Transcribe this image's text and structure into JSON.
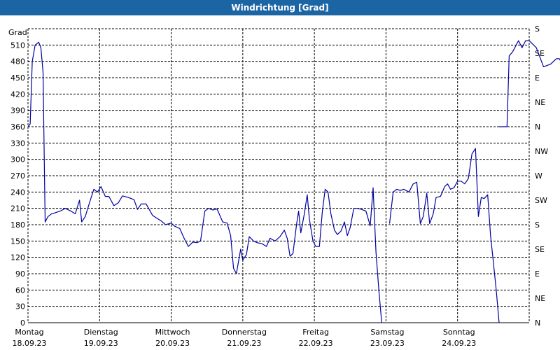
{
  "window": {
    "title": "Windrichtung [Grad]"
  },
  "chart_data": {
    "type": "line",
    "title": "Windrichtung [Grad]",
    "ylabel": "Grad",
    "ylim": [
      0,
      540
    ],
    "y_ticks": [
      0,
      30,
      60,
      90,
      120,
      150,
      180,
      210,
      240,
      270,
      300,
      330,
      360,
      390,
      420,
      450,
      480,
      510
    ],
    "right_axis_ticks": [
      {
        "value": 0,
        "label": "N"
      },
      {
        "value": 45,
        "label": "NE"
      },
      {
        "value": 90,
        "label": "E"
      },
      {
        "value": 135,
        "label": "SE"
      },
      {
        "value": 180,
        "label": "S"
      },
      {
        "value": 225,
        "label": "SW"
      },
      {
        "value": 270,
        "label": "W"
      },
      {
        "value": 315,
        "label": "NW"
      },
      {
        "value": 360,
        "label": "N"
      },
      {
        "value": 405,
        "label": "NE"
      },
      {
        "value": 450,
        "label": "E"
      },
      {
        "value": 495,
        "label": "SE"
      },
      {
        "value": 540,
        "label": "S"
      }
    ],
    "x_unit": "day",
    "xlim": [
      0,
      7
    ],
    "x_ticks": [
      {
        "x": 0,
        "day": "Montag",
        "date": "18.09.23"
      },
      {
        "x": 1,
        "day": "Dienstag",
        "date": "19.09.23"
      },
      {
        "x": 2,
        "day": "Mittwoch",
        "date": "20.09.23"
      },
      {
        "x": 3,
        "day": "Donnerstag",
        "date": "21.09.23"
      },
      {
        "x": 4,
        "day": "Freitag",
        "date": "22.09.23"
      },
      {
        "x": 5,
        "day": "Samstag",
        "date": "23.09.23"
      },
      {
        "x": 6,
        "day": "Sonntag",
        "date": "24.09.23"
      }
    ],
    "grid": true,
    "series": [
      {
        "color": "#0000a0",
        "segments": [
          [
            [
              0.0,
              360
            ],
            [
              0.03,
              365
            ],
            [
              0.06,
              480
            ],
            [
              0.1,
              510
            ],
            [
              0.15,
              515
            ],
            [
              0.18,
              505
            ],
            [
              0.21,
              460
            ],
            [
              0.24,
              185
            ],
            [
              0.28,
              195
            ],
            [
              0.33,
              200
            ],
            [
              0.38,
              202
            ],
            [
              0.45,
              205
            ],
            [
              0.52,
              210
            ],
            [
              0.6,
              205
            ],
            [
              0.66,
              200
            ],
            [
              0.72,
              225
            ],
            [
              0.75,
              185
            ],
            [
              0.8,
              195
            ],
            [
              0.87,
              225
            ],
            [
              0.92,
              245
            ],
            [
              0.97,
              240
            ],
            [
              1.02,
              250
            ],
            [
              1.08,
              232
            ],
            [
              1.13,
              232
            ],
            [
              1.2,
              215
            ],
            [
              1.26,
              220
            ],
            [
              1.32,
              233
            ],
            [
              1.4,
              230
            ],
            [
              1.48,
              226
            ],
            [
              1.53,
              208
            ],
            [
              1.58,
              218
            ],
            [
              1.65,
              218
            ],
            [
              1.74,
              197
            ],
            [
              1.8,
              192
            ],
            [
              1.86,
              187
            ],
            [
              1.92,
              180
            ],
            [
              2.0,
              183
            ],
            [
              2.05,
              177
            ],
            [
              2.12,
              173
            ],
            [
              2.18,
              155
            ],
            [
              2.24,
              140
            ],
            [
              2.3,
              148
            ],
            [
              2.36,
              147
            ],
            [
              2.41,
              150
            ],
            [
              2.47,
              205
            ],
            [
              2.52,
              210
            ],
            [
              2.58,
              207
            ],
            [
              2.64,
              209
            ],
            [
              2.72,
              185
            ],
            [
              2.78,
              183
            ],
            [
              2.83,
              160
            ],
            [
              2.87,
              100
            ],
            [
              2.91,
              90
            ],
            [
              2.97,
              135
            ],
            [
              3.0,
              115
            ],
            [
              3.05,
              125
            ],
            [
              3.09,
              158
            ],
            [
              3.15,
              150
            ],
            [
              3.2,
              147
            ],
            [
              3.27,
              145
            ],
            [
              3.33,
              140
            ],
            [
              3.38,
              155
            ],
            [
              3.45,
              150
            ],
            [
              3.52,
              158
            ],
            [
              3.58,
              170
            ],
            [
              3.62,
              155
            ],
            [
              3.66,
              122
            ],
            [
              3.7,
              127
            ],
            [
              3.75,
              180
            ],
            [
              3.78,
              205
            ],
            [
              3.81,
              165
            ],
            [
              3.86,
              200
            ],
            [
              3.9,
              235
            ],
            [
              3.93,
              190
            ],
            [
              3.98,
              150
            ],
            [
              4.02,
              140
            ],
            [
              4.07,
              140
            ],
            [
              4.11,
              203
            ],
            [
              4.15,
              245
            ],
            [
              4.19,
              240
            ],
            [
              4.23,
              200
            ],
            [
              4.28,
              170
            ],
            [
              4.32,
              162
            ],
            [
              4.37,
              168
            ],
            [
              4.42,
              185
            ],
            [
              4.46,
              160
            ],
            [
              4.5,
              175
            ],
            [
              4.55,
              210
            ],
            [
              4.6,
              210
            ],
            [
              4.66,
              208
            ],
            [
              4.72,
              205
            ],
            [
              4.78,
              178
            ],
            [
              4.82,
              248
            ],
            [
              4.86,
              130
            ],
            [
              4.9,
              60
            ],
            [
              4.94,
              0
            ]
          ],
          [
            [
              5.05,
              182
            ],
            [
              5.1,
              240
            ],
            [
              5.15,
              245
            ],
            [
              5.2,
              243
            ],
            [
              5.25,
              245
            ],
            [
              5.32,
              240
            ],
            [
              5.38,
              255
            ],
            [
              5.43,
              258
            ],
            [
              5.48,
              182
            ],
            [
              5.52,
              195
            ],
            [
              5.57,
              238
            ],
            [
              5.61,
              182
            ],
            [
              5.66,
              200
            ],
            [
              5.7,
              230
            ],
            [
              5.76,
              232
            ],
            [
              5.82,
              250
            ],
            [
              5.86,
              255
            ],
            [
              5.9,
              245
            ],
            [
              5.95,
              248
            ],
            [
              6.0,
              260
            ],
            [
              6.05,
              260
            ],
            [
              6.1,
              255
            ],
            [
              6.15,
              265
            ],
            [
              6.2,
              310
            ],
            [
              6.25,
              320
            ],
            [
              6.29,
              195
            ],
            [
              6.33,
              230
            ],
            [
              6.37,
              228
            ],
            [
              6.42,
              235
            ],
            [
              6.46,
              160
            ],
            [
              6.5,
              110
            ],
            [
              6.54,
              60
            ],
            [
              6.58,
              0
            ]
          ],
          [
            [
              6.58,
              360
            ],
            [
              6.69,
              360
            ],
            [
              6.72,
              490
            ],
            [
              6.77,
              498
            ],
            [
              6.85,
              518
            ],
            [
              6.9,
              505
            ],
            [
              6.95,
              518
            ],
            [
              7.0,
              518
            ],
            [
              7.1,
              505
            ],
            [
              7.2,
              470
            ],
            [
              7.3,
              475
            ],
            [
              7.38,
              485
            ],
            [
              7.42,
              485
            ],
            [
              7.46,
              476
            ],
            [
              7.5,
              480
            ]
          ]
        ]
      }
    ]
  }
}
